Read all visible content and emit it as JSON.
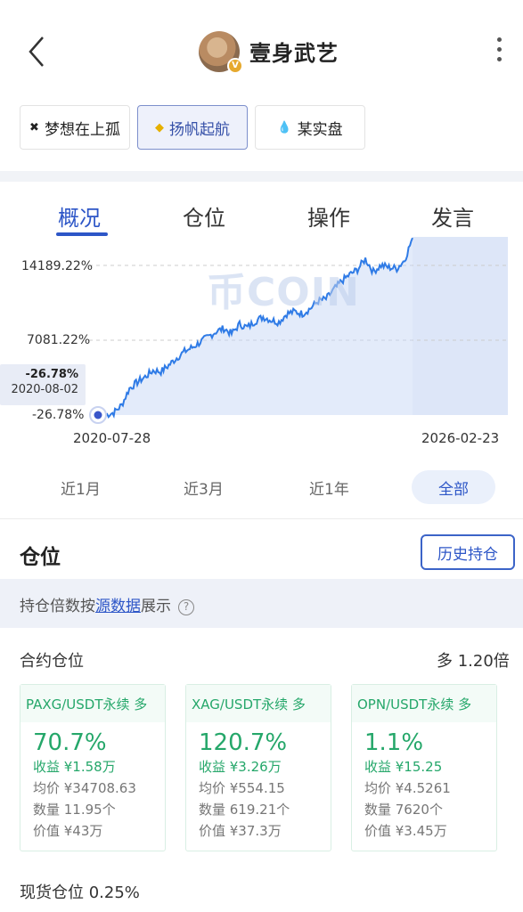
{
  "header": {
    "title": "壹身武艺",
    "avatar_badge": "V"
  },
  "accounts": [
    {
      "icon": "✖",
      "label": "梦想在上孤",
      "active": false
    },
    {
      "icon": "◆",
      "label": "扬帆起航",
      "active": true
    },
    {
      "icon": "💧",
      "label": "某实盘",
      "active": false
    }
  ],
  "tabs": [
    "概况",
    "仓位",
    "操作",
    "发言"
  ],
  "chart_data": {
    "type": "area",
    "y_ticks": [
      "14189.22%",
      "7081.22%",
      "-26.78%"
    ],
    "x_ticks": [
      "2020-07-28",
      "2026-02-23"
    ],
    "watermark": "币COIN",
    "tooltip": {
      "value": "-26.78%",
      "date": "2020-08-02"
    },
    "ylim": [
      -26.78,
      14189.22
    ],
    "series": [
      {
        "values": [
          -26.78,
          -20,
          200,
          900,
          2500,
          3100,
          3600,
          4200,
          4100,
          4700,
          5400,
          6000,
          6400,
          6900,
          7400,
          7900,
          8200,
          7700,
          8600,
          8300,
          8900,
          9300,
          9000,
          8800,
          9600,
          9800,
          9600,
          10100,
          10800,
          11000,
          11900,
          12700,
          13300,
          13800,
          14800,
          13600,
          14200,
          14000,
          13900,
          14700,
          16800
        ],
        "color": "#2f7be6"
      }
    ]
  },
  "ranges": [
    "近1月",
    "近3月",
    "近1年",
    "全部"
  ],
  "positions": {
    "title": "仓位",
    "history_button": "历史持仓",
    "note_prefix": "持仓倍数按",
    "note_link": "源数据",
    "note_suffix": "展示",
    "help": "?",
    "contract_title": "合约仓位",
    "contract_multiplier": "多 1.20倍",
    "cards": [
      {
        "name": "PAXG/USDT永续 多",
        "pct": "70.7%",
        "profit": "收益 ¥1.58万",
        "avg": "均价 ¥34708.63",
        "qty": "数量 11.95个",
        "value": "价值 ¥43万"
      },
      {
        "name": "XAG/USDT永续 多",
        "pct": "120.7%",
        "profit": "收益 ¥3.26万",
        "avg": "均价 ¥554.15",
        "qty": "数量 619.21个",
        "value": "价值 ¥37.3万"
      },
      {
        "name": "OPN/USDT永续 多",
        "pct": "1.1%",
        "profit": "收益 ¥15.25",
        "avg": "均价 ¥4.5261",
        "qty": "数量 7620个",
        "value": "价值 ¥3.45万"
      }
    ],
    "spot": "现货仓位 0.25%"
  },
  "colors": {
    "accent": "#2d56c7",
    "green": "#25a76a",
    "line": "#2f7be6"
  }
}
